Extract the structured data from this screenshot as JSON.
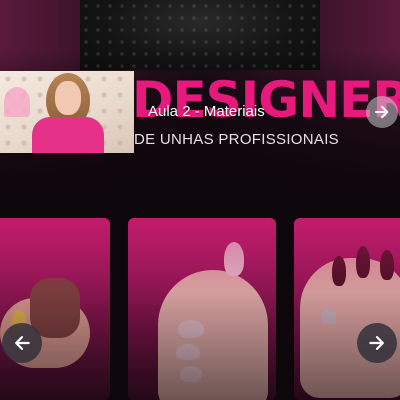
{
  "hero": {
    "title": "DESIGNER",
    "subtitle": "DE UNHAS PROFISSIONAIS"
  },
  "pip_player": {
    "lesson_title": "Aula 2 - Materiais"
  },
  "lesson_cards": [
    {
      "label": ""
    },
    {
      "label": ""
    },
    {
      "label": ""
    }
  ],
  "icons": {
    "hero_next": "arrow-right-icon",
    "carousel_prev": "arrow-left-icon",
    "carousel_next": "arrow-right-icon"
  },
  "colors": {
    "accent": "#e8197d",
    "background": "#0d060b",
    "card_pink": "#c21c6c"
  }
}
